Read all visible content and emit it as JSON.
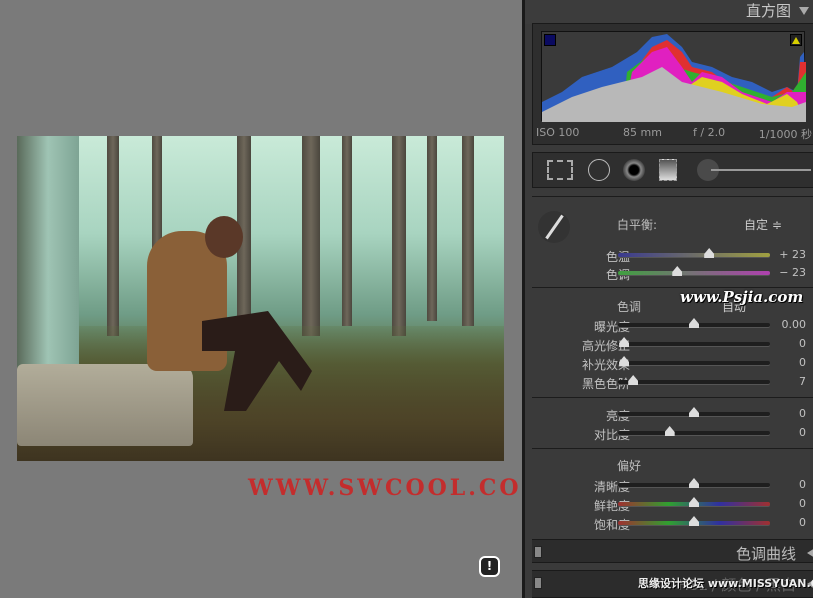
{
  "histogram": {
    "title": "直方图",
    "iso": "ISO 100",
    "focal": "85 mm",
    "aperture": "f / 2.0",
    "shutter": "1/1000 秒"
  },
  "basic": {
    "white_balance_label": "白平衡:",
    "white_balance_value": "自定 ≑",
    "wb_sliders": [
      {
        "label": "色温",
        "value": "+ 23",
        "position": 0.6
      },
      {
        "label": "色调",
        "value": "− 23",
        "position": 0.39
      }
    ],
    "tone_title": "色调",
    "tone_auto": "自动",
    "tone_sliders": [
      {
        "label": "曝光度",
        "value": "0.00",
        "position": 0.5
      },
      {
        "label": "高光修正",
        "value": "0",
        "position": 0.04
      },
      {
        "label": "补光效果",
        "value": "0",
        "position": 0.04
      },
      {
        "label": "黑色色阶",
        "value": "7",
        "position": 0.1
      }
    ],
    "bc_sliders": [
      {
        "label": "亮度",
        "value": "0",
        "position": 0.5
      },
      {
        "label": "对比度",
        "value": "0",
        "position": 0.34
      }
    ],
    "presence_title": "偏好",
    "presence_sliders": [
      {
        "label": "清晰度",
        "value": "0",
        "position": 0.5
      },
      {
        "label": "鲜艳度",
        "value": "0",
        "position": 0.5
      },
      {
        "label": "饱和度",
        "value": "0",
        "position": 0.5
      }
    ]
  },
  "panels": {
    "tone_curve": "色调曲线",
    "hsl": "HSL / 颜色 / 黑白"
  },
  "watermarks": {
    "swcool": "WWW.SWCOOL.COM@渐",
    "psjia": "www.Psjia.com",
    "missyuan": "思缘设计论坛 www.MISSYUAN.COM"
  },
  "alert": "!"
}
